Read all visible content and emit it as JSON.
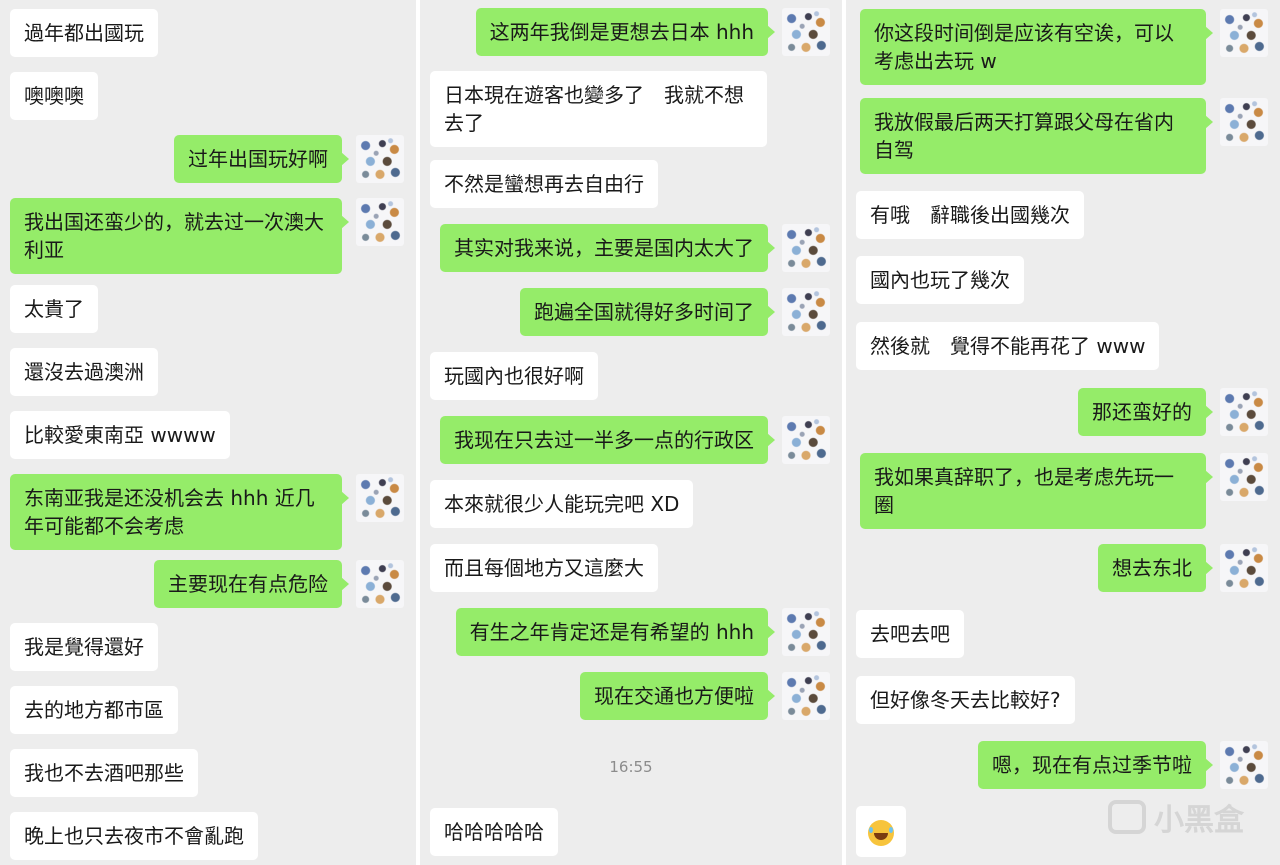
{
  "columns": [
    {
      "messages": [
        {
          "side": "left",
          "text": "過年都出國玩"
        },
        {
          "side": "left",
          "text": "噢噢噢"
        },
        {
          "side": "right",
          "text": "过年出国玩好啊"
        },
        {
          "side": "right",
          "text": "我出国还蛮少的，就去过一次澳大利亚"
        },
        {
          "side": "left",
          "text": "太貴了"
        },
        {
          "side": "left",
          "text": "還沒去過澳洲"
        },
        {
          "side": "left",
          "text": "比較愛東南亞 wwww"
        },
        {
          "side": "right",
          "text": "东南亚我是还没机会去 hhh 近几年可能都不会考虑"
        },
        {
          "side": "right",
          "text": "主要现在有点危险"
        },
        {
          "side": "left",
          "text": "我是覺得還好"
        },
        {
          "side": "left",
          "text": "去的地方都市區"
        },
        {
          "side": "left",
          "text": "我也不去酒吧那些"
        },
        {
          "side": "left",
          "text": "晚上也只去夜市不會亂跑"
        }
      ]
    },
    {
      "messages": [
        {
          "side": "right",
          "text": "这两年我倒是更想去日本 hhh"
        },
        {
          "side": "left",
          "text": "日本現在遊客也變多了　我就不想去了"
        },
        {
          "side": "left",
          "text": "不然是蠻想再去自由行"
        },
        {
          "side": "right",
          "text": "其实对我来说，主要是国内太大了"
        },
        {
          "side": "right",
          "text": "跑遍全国就得好多时间了"
        },
        {
          "side": "left",
          "text": "玩國內也很好啊"
        },
        {
          "side": "right",
          "text": "我现在只去过一半多一点的行政区"
        },
        {
          "side": "left",
          "text": "本來就很少人能玩完吧 XD"
        },
        {
          "side": "left",
          "text": "而且每個地方又這麼大"
        },
        {
          "side": "right",
          "text": "有生之年肯定还是有希望的 hhh"
        },
        {
          "side": "right",
          "text": "现在交通也方便啦"
        },
        {
          "side": "time",
          "text": "16:55"
        },
        {
          "side": "left",
          "text": "哈哈哈哈哈"
        }
      ]
    },
    {
      "messages": [
        {
          "side": "right",
          "text": "你这段时间倒是应该有空诶，可以考虑出去玩 w"
        },
        {
          "side": "right",
          "text": "我放假最后两天打算跟父母在省内自驾"
        },
        {
          "side": "left",
          "text": "有哦　辭職後出國幾次"
        },
        {
          "side": "left",
          "text": "國內也玩了幾次"
        },
        {
          "side": "left",
          "text": "然後就　覺得不能再花了 www"
        },
        {
          "side": "right",
          "text": "那还蛮好的"
        },
        {
          "side": "right",
          "text": "我如果真辞职了，也是考虑先玩一圈"
        },
        {
          "side": "right",
          "text": "想去东北"
        },
        {
          "side": "left",
          "text": "去吧去吧"
        },
        {
          "side": "left",
          "text": "但好像冬天去比較好?"
        },
        {
          "side": "right",
          "text": "嗯，现在有点过季节啦"
        },
        {
          "side": "left",
          "emoji": "laughing-tears-emoji",
          "text": ""
        }
      ]
    }
  ],
  "watermark": {
    "text": "小黑盒"
  },
  "colors": {
    "background": "#ededed",
    "bubble_sent": "#95ec69",
    "bubble_received": "#ffffff",
    "text": "#191919"
  }
}
